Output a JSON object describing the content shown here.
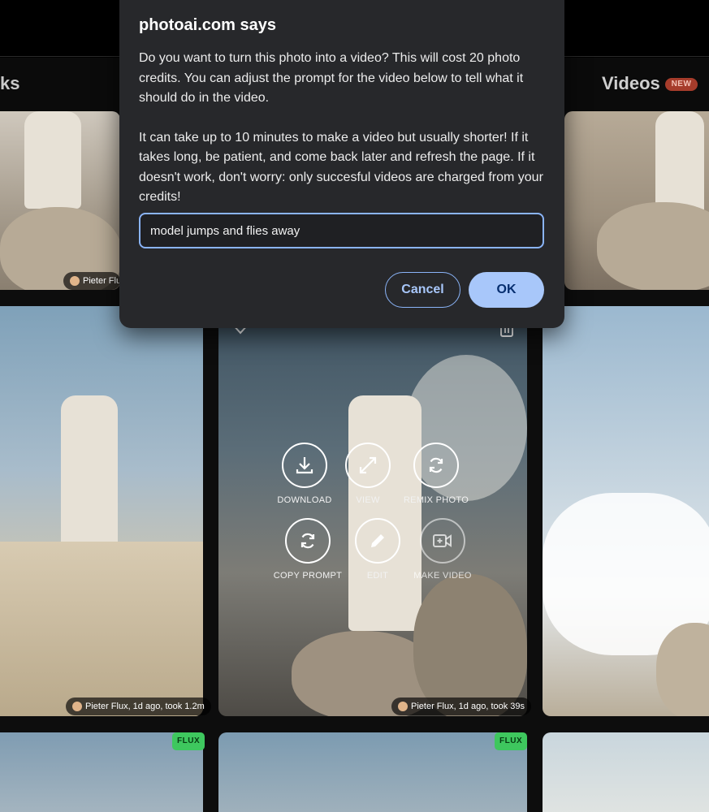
{
  "nav": {
    "left_tab_fragment": "ks",
    "videos_tab_label": "Videos",
    "new_badge": "NEW"
  },
  "dialog": {
    "title": "photoai.com says",
    "message_p1": "Do you want to turn this photo into a video? This will cost 20 photo credits. You can adjust the prompt for the video below to tell what it should do in the video.",
    "message_p2": "It can take up to 10 minutes to make a video but usually shorter! If it takes long, be patient, and come back later and refresh the page. If it doesn't work, don't worry: only succesful videos are charged from your credits!",
    "prompt_value": "model jumps and flies away",
    "cancel_label": "Cancel",
    "ok_label": "OK"
  },
  "cards": {
    "top_left_credit": "Pieter Flu",
    "mid_left_credit": "Pieter Flux, 1d ago, took 1.2m",
    "mid_center_credit": "Pieter Flux, 1d ago, took 39s",
    "flux_badge": "FLUX"
  },
  "card_actions": {
    "download": "DOWNLOAD",
    "view": "VIEW",
    "remix_photo": "REMIX PHOTO",
    "copy_prompt": "COPY PROMPT",
    "edit": "EDIT",
    "make_video": "MAKE VIDEO"
  },
  "colors": {
    "dialog_bg": "#27282b",
    "accent_blue": "#a8c7fa",
    "flux_green": "#3ec75e",
    "new_badge_red": "#a63c2b"
  }
}
